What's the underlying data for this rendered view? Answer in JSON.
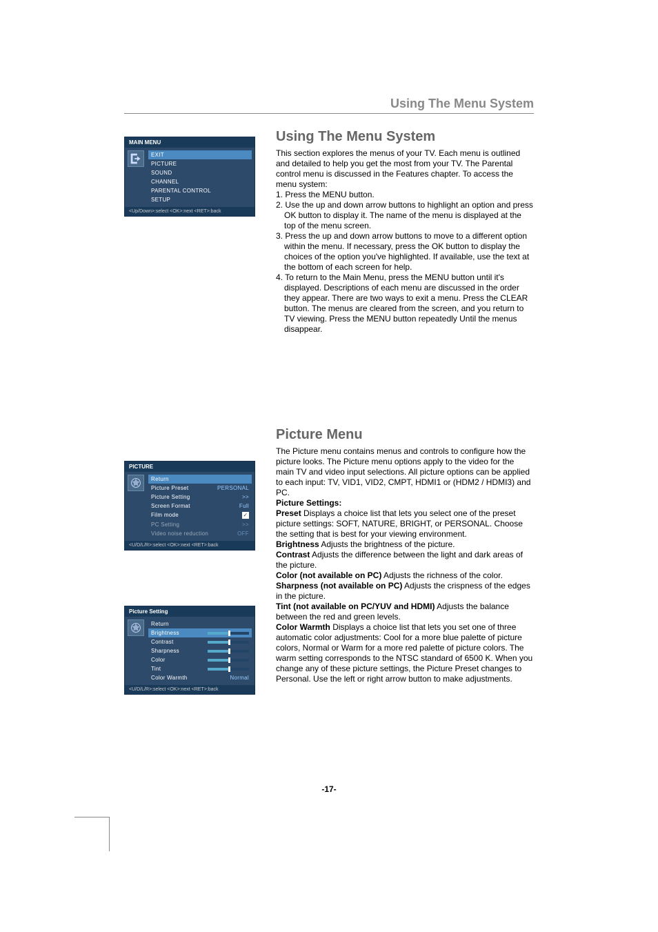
{
  "header": {
    "title": "Using The Menu System"
  },
  "section1": {
    "title": "Using The Menu System",
    "intro": "This section explores the menus of your TV. Each menu is outlined and detailed to help you get the most from your TV. The Parental control menu is discussed in the Features chapter. To access the menu system:",
    "steps": [
      "Press the MENU button.",
      "Use the up and down arrow buttons to highlight an option and press OK button to display it. The name of the menu is displayed at the top of the menu screen.",
      "Press the up and down arrow buttons to move to a different option within the menu. If necessary, press the OK button to display the choices of the option you've highlighted. If available, use the text at the bottom of each screen for help.",
      "To return to the Main Menu, press the MENU button until it's displayed. Descriptions of each menu are discussed in the order they appear. There are two ways to exit a menu. Press the CLEAR button. The menus are cleared from the screen, and you return to TV viewing. Press the MENU button repeatedly Until the menus disappear."
    ]
  },
  "section2": {
    "title": "Picture Menu",
    "intro": "The Picture menu contains menus and controls to configure how the picture looks. The Picture menu options apply to the video for the main TV and video input selections. All picture options can be applied to each input: TV, VID1, VID2, CMPT, HDMI1 or (HDM2 / HDMI3) and PC.",
    "settings_label": "Picture Settings:",
    "items": {
      "preset": {
        "label": "Preset",
        "text": " Displays a choice list that lets you select one of the preset picture settings: SOFT, NATURE, BRIGHT, or PERSONAL. Choose the setting that is best for your viewing environment."
      },
      "brightness": {
        "label": "Brightness",
        "text": " Adjusts the brightness of the picture."
      },
      "contrast": {
        "label": "Contrast",
        "text": " Adjusts the difference between the light and dark areas of the picture."
      },
      "color": {
        "label": "Color (not available on PC)",
        "text": " Adjusts the richness of the color."
      },
      "sharpness": {
        "label": "Sharpness (not available on PC)",
        "text": " Adjusts the crispness of the edges in the picture."
      },
      "tint": {
        "label": "Tint (not available on PC/YUV and HDMI)",
        "text": " Adjusts the balance between the red and green levels."
      },
      "warmth": {
        "label": "Color Warmth",
        "text": " Displays a choice list that lets you set one of three automatic color adjustments: Cool for a more blue palette of picture colors, Normal or Warm for a more red palette of picture colors. The warm setting corresponds to the NTSC standard of 6500 K. When you change any of these picture settings, the Picture Preset changes to Personal. Use the left or right arrow button to make adjustments."
      }
    }
  },
  "main_menu": {
    "title": "MAIN MENU",
    "items": [
      "EXIT",
      "PICTURE",
      "SOUND",
      "CHANNEL",
      "PARENTAL CONTROL",
      "SETUP"
    ],
    "footer": "<Up/Down>:select  <OK>:next  <RET>:back"
  },
  "picture_menu": {
    "title": "PICTURE",
    "items": [
      {
        "label": "Return",
        "value": "",
        "hl": true
      },
      {
        "label": "Picture Preset",
        "value": "PERSONAL"
      },
      {
        "label": "Picture Setting",
        "value": ">>"
      },
      {
        "label": "Screen Format",
        "value": "Full"
      },
      {
        "label": "Film mode",
        "value": "check"
      },
      {
        "label": "PC Setting",
        "value": ">>",
        "dim": true
      },
      {
        "label": "Video noise reduction",
        "value": "OFF",
        "dim": true
      }
    ],
    "footer": "<U/D/L/R>:select  <OK>:next  <RET>:back"
  },
  "picture_setting": {
    "title": "Picture Setting",
    "items": [
      {
        "label": "Return",
        "value": ""
      },
      {
        "label": "Brightness",
        "value": "slider",
        "hl": true
      },
      {
        "label": "Contrast",
        "value": "slider"
      },
      {
        "label": "Sharpness",
        "value": "slider"
      },
      {
        "label": "Color",
        "value": "slider"
      },
      {
        "label": "Tint",
        "value": "slider"
      },
      {
        "label": "Color Warmth",
        "value": "Normal"
      }
    ],
    "footer": "<U/D/L/R>:select  <OK>:next  <RET>:back"
  },
  "page_number": "-17-"
}
